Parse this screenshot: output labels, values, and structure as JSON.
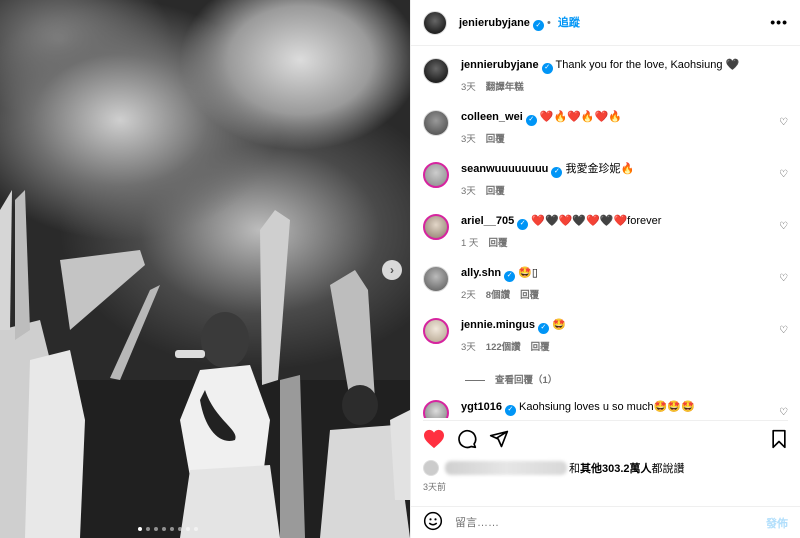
{
  "photo": {
    "next_icon": "chevron-right-icon",
    "carousel_dots": 8,
    "carousel_active": 0
  },
  "header": {
    "username": "jenierubyjane",
    "follow_label": "追蹤",
    "more_label": "•••"
  },
  "caption": {
    "username": "jennierubyjane",
    "text": "Thank you for the love, Kaohsiung 🖤",
    "time": "3天",
    "translate_label": "翻譯年糕"
  },
  "comments": [
    {
      "username": "colleen_wei",
      "text": "❤️🔥❤️🔥❤️🔥",
      "time": "3天",
      "likes": "",
      "reply_label": "回覆"
    },
    {
      "username": "seanwuuuuuuuu",
      "text": "我愛金珍妮🔥",
      "time": "3天",
      "likes": "",
      "reply_label": "回覆"
    },
    {
      "username": "ariel__705",
      "text": "❤️🖤❤️🖤❤️🖤❤️forever",
      "time": "1 天",
      "likes": "",
      "reply_label": "回覆"
    },
    {
      "username": "ally.shn",
      "text": "🤩▯",
      "time": "2天",
      "likes": "8個讚",
      "reply_label": "回覆"
    },
    {
      "username": "jennie.mingus",
      "text": "🤩",
      "time": "3天",
      "likes": "122個讚",
      "reply_label": "回覆"
    },
    {
      "username": "ygt1016",
      "text": "Kaohsiung loves u so much🤩🤩🤩",
      "time": "",
      "likes": "",
      "reply_label": ""
    }
  ],
  "view_replies_label": "查看回覆（1）",
  "likes_text_prefix": "和",
  "likes_text_bold": "其他303.2萬人",
  "likes_text_suffix": "都說讚",
  "post_time": "3天前",
  "comment_input": {
    "placeholder": "留言……",
    "post_label": "發佈"
  },
  "colors": {
    "accent": "#0095f6",
    "heart": "#ff3040",
    "muted": "#737373"
  }
}
